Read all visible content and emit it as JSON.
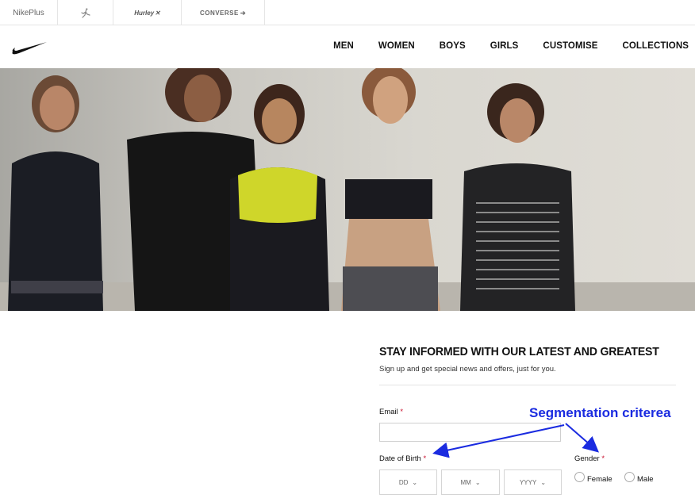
{
  "brands": {
    "nikeplus": "NikePlus",
    "jordan_icon": "jumpman-icon",
    "hurley": "Hurley",
    "converse": "CONVERSE"
  },
  "nav": [
    "MEN",
    "WOMEN",
    "BOYS",
    "GIRLS",
    "CUSTOMISE",
    "COLLECTIONS"
  ],
  "signup": {
    "title": "STAY INFORMED WITH OUR LATEST AND GREATEST",
    "subtitle": "Sign up and get special news and offers, just for you.",
    "email_label": "Email",
    "dob_label": "Date of Birth",
    "gender_label": "Gender",
    "required_mark": "*",
    "dd": "DD",
    "mm": "MM",
    "yyyy": "YYYY",
    "female": "Female",
    "male": "Male"
  },
  "annotation": {
    "text": "Segmentation criterea",
    "color": "#1a2be0"
  },
  "colors": {
    "required": "#c8102e",
    "nav_text": "#111111"
  }
}
